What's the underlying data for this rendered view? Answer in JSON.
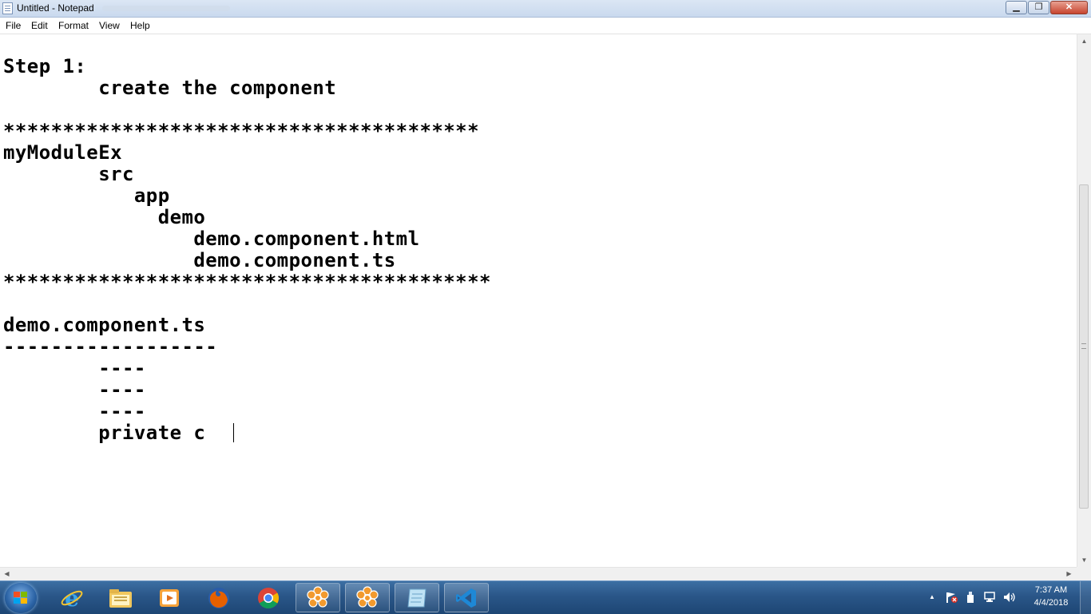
{
  "window": {
    "title": "Untitled - Notepad",
    "minimize_glyph": "▁",
    "maximize_glyph": "❐",
    "close_glyph": "✕"
  },
  "menu": {
    "file": "File",
    "edit": "Edit",
    "format": "Format",
    "view": "View",
    "help": "Help"
  },
  "editor": {
    "content": "Step 1:\n\tcreate the component\n\n****************************************\nmyModuleEx\n\tsrc\n\t   app\n\t     demo\n\t\tdemo.component.html\n\t\tdemo.component.ts\n*****************************************\n\ndemo.component.ts\n------------------\n\t----\n\t----\n\t----\n\tprivate c"
  },
  "scrollbars": {
    "up_arrow": "▲",
    "down_arrow": "▼",
    "left_arrow": "◀",
    "right_arrow": "▶"
  },
  "taskbar": {
    "apps": [
      {
        "name": "internet-explorer-icon",
        "open": false
      },
      {
        "name": "file-explorer-icon",
        "open": false
      },
      {
        "name": "media-player-icon",
        "open": false
      },
      {
        "name": "firefox-icon",
        "open": false
      },
      {
        "name": "chrome-icon",
        "open": false
      },
      {
        "name": "app-flower-icon",
        "open": true
      },
      {
        "name": "app-flower-icon",
        "open": true
      },
      {
        "name": "notepad-icon",
        "open": true
      },
      {
        "name": "vscode-icon",
        "open": true
      }
    ],
    "tray": {
      "show_hidden_glyph": "▲",
      "time": "7:37 AM",
      "date": "4/4/2018"
    }
  },
  "colors": {
    "firefox": "#e66000",
    "chrome_red": "#db4437",
    "chrome_green": "#0f9d58",
    "chrome_yellow": "#f4b400",
    "chrome_blue": "#4285f4",
    "flower": "#f29a2e",
    "vscode": "#1e88d6",
    "ie": "#3aa6ec"
  }
}
